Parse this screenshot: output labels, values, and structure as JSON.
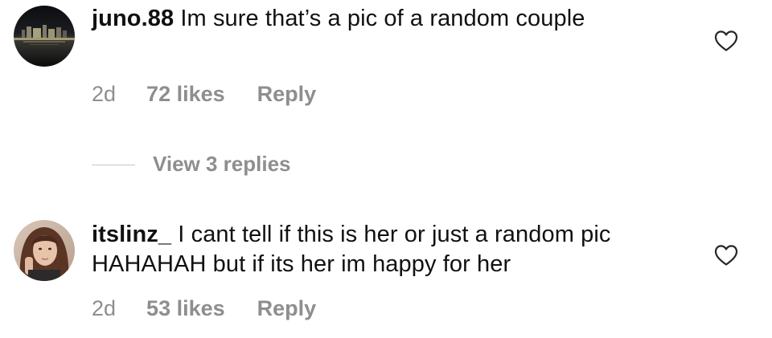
{
  "comments": [
    {
      "username": "juno.88",
      "text": "Im sure that’s a pic of a random couple",
      "time": "2d",
      "likes": "72 likes",
      "reply": "Reply",
      "view_replies": "View 3 replies",
      "avatar": "city-night-skyline-avatar"
    },
    {
      "username": "itslinz_",
      "text": "I cant tell if this is her or just a random pic HAHAHAH but if its her im happy for her",
      "time": "2d",
      "likes": "53 likes",
      "reply": "Reply",
      "avatar": "person-selfie-avatar"
    }
  ],
  "icons": {
    "like": "heart-outline-icon"
  },
  "colors": {
    "text": "#111111",
    "meta": "#8e8e8e",
    "divider": "#c7c7c7"
  }
}
